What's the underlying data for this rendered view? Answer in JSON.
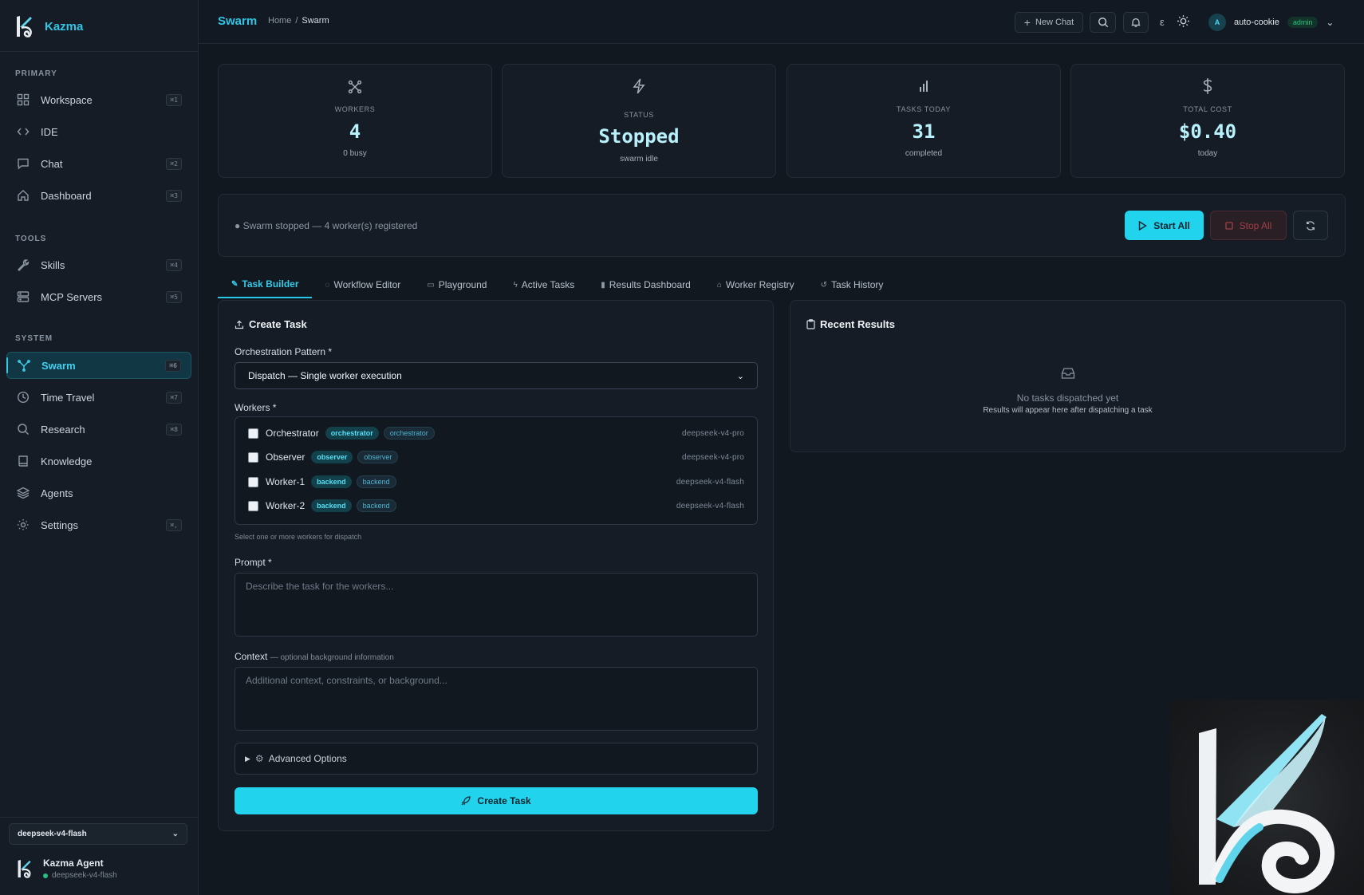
{
  "app": {
    "name": "Kazma"
  },
  "sidebar": {
    "sections": [
      {
        "label": "PRIMARY"
      },
      {
        "label": "TOOLS"
      },
      {
        "label": "SYSTEM"
      }
    ],
    "items": [
      {
        "label": "Workspace",
        "shortcut": "⌘1",
        "icon": "grid-icon"
      },
      {
        "label": "IDE",
        "shortcut": "",
        "icon": "code-icon"
      },
      {
        "label": "Chat",
        "shortcut": "⌘2",
        "icon": "chat-icon"
      },
      {
        "label": "Dashboard",
        "shortcut": "⌘3",
        "icon": "home-icon"
      },
      {
        "label": "Skills",
        "shortcut": "⌘4",
        "icon": "wrench-icon"
      },
      {
        "label": "MCP Servers",
        "shortcut": "⌘5",
        "icon": "server-icon"
      },
      {
        "label": "Swarm",
        "shortcut": "⌘6",
        "icon": "swarm-icon"
      },
      {
        "label": "Time Travel",
        "shortcut": "⌘7",
        "icon": "clock-icon"
      },
      {
        "label": "Research",
        "shortcut": "⌘8",
        "icon": "search-icon"
      },
      {
        "label": "Knowledge",
        "shortcut": "",
        "icon": "book-icon"
      },
      {
        "label": "Agents",
        "shortcut": "",
        "icon": "layers-icon"
      },
      {
        "label": "Settings",
        "shortcut": "⌘,",
        "icon": "gear-icon"
      }
    ],
    "model_select": "deepseek-v4-flash",
    "agent": {
      "name": "Kazma Agent",
      "model": "deepseek-v4-flash"
    }
  },
  "header": {
    "title": "Swarm",
    "breadcrumb": {
      "home": "Home",
      "sep": "/",
      "current": "Swarm"
    },
    "new_chat": "New Chat",
    "lang_glyph": "ε",
    "user": {
      "initial": "A",
      "name": "auto-cookie",
      "role": "admin"
    }
  },
  "stats": [
    {
      "label": "WORKERS",
      "value": "4",
      "sub": "0 busy",
      "icon": "network-icon"
    },
    {
      "label": "STATUS",
      "value": "Stopped",
      "sub": "swarm idle",
      "icon": "bolt-icon"
    },
    {
      "label": "TASKS TODAY",
      "value": "31",
      "sub": "completed",
      "icon": "bar-chart-icon"
    },
    {
      "label": "TOTAL COST",
      "value": "$0.40",
      "sub": "today",
      "icon": "dollar-icon"
    }
  ],
  "status": {
    "text": "● Swarm stopped — 4 worker(s) registered",
    "start_label": "Start All",
    "stop_label": "Stop All"
  },
  "tabs": [
    {
      "label": "Task Builder",
      "icon": "✎"
    },
    {
      "label": "Workflow Editor",
      "icon": "◌"
    },
    {
      "label": "Playground",
      "icon": "▭"
    },
    {
      "label": "Active Tasks",
      "icon": "ϟ"
    },
    {
      "label": "Results Dashboard",
      "icon": "▮"
    },
    {
      "label": "Worker Registry",
      "icon": "⌂"
    },
    {
      "label": "Task History",
      "icon": "↺"
    }
  ],
  "create_task": {
    "title": "Create Task",
    "pattern_label": "Orchestration Pattern *",
    "pattern_value": "Dispatch — Single worker execution",
    "workers_label": "Workers *",
    "workers": [
      {
        "name": "Orchestrator",
        "role": "orchestrator",
        "tag": "orchestrator",
        "model": "deepseek-v4-pro"
      },
      {
        "name": "Observer",
        "role": "observer",
        "tag": "observer",
        "model": "deepseek-v4-pro"
      },
      {
        "name": "Worker-1",
        "role": "backend",
        "tag": "backend",
        "model": "deepseek-v4-flash"
      },
      {
        "name": "Worker-2",
        "role": "backend",
        "tag": "backend",
        "model": "deepseek-v4-flash"
      }
    ],
    "workers_hint": "Select one or more workers for dispatch",
    "prompt_label": "Prompt *",
    "prompt_placeholder": "Describe the task for the workers...",
    "context_label": "Context",
    "context_sub": "— optional background information",
    "context_placeholder": "Additional context, constraints, or background...",
    "advanced_label": "Advanced Options",
    "submit_label": "Create Task"
  },
  "recent_results": {
    "title": "Recent Results",
    "empty_title": "No tasks dispatched yet",
    "empty_sub": "Results will appear here after dispatching a task"
  }
}
